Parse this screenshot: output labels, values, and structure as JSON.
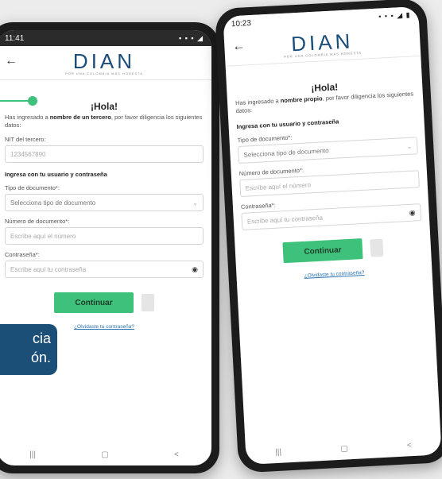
{
  "phone_left": {
    "status_time": "11:41",
    "status_icons": "▪ ▪ ▪ ◢",
    "logo": "DIAN",
    "logo_sub": "POR UNA COLOMBIA MÁS HONESTA",
    "greeting": "¡Hola!",
    "intro_pre": "Has ingresado a ",
    "intro_bold": "nombre de un tercero",
    "intro_post": ", por favor diligencia los siguientes datos:",
    "nit_label": "NIT del tercero:",
    "nit_value": "1234567890",
    "section_title": "Ingresa con tu usuario y contraseña",
    "doc_type_label": "Tipo de documento*:",
    "doc_type_placeholder": "Selecciona tipo de documento",
    "doc_number_label": "Número de documento*:",
    "doc_number_placeholder": "Escribe aquí el número",
    "password_label": "Contraseña*:",
    "password_placeholder": "Escribe aquí tu contraseña",
    "continue_label": "Continuar",
    "forgot_label": "¿Olvidaste tu contraseña?",
    "nav_icons": [
      "|||",
      "▢",
      "<"
    ]
  },
  "phone_right": {
    "status_time": "10:23",
    "status_icons": "▪ ▪ ▪ ◢ ▮",
    "logo": "DIAN",
    "logo_sub": "POR UNA COLOMBIA MÁS HONESTA",
    "greeting": "¡Hola!",
    "intro_pre": "Has ingresado a ",
    "intro_bold": "nombre propio",
    "intro_post": ", por favor diligencia los siguientes datos:",
    "section_title": "Ingresa con tu usuario y contraseña",
    "doc_type_label": "Tipo de documento*:",
    "doc_type_placeholder": "Selecciona tipo de documento",
    "doc_number_label": "Número de documento*:",
    "doc_number_placeholder": "Escribe aquí el número",
    "password_label": "Contraseña*:",
    "password_placeholder": "Escribe aquí tu contraseña",
    "continue_label": "Continuar",
    "forgot_label": "¿Olvidaste tu contraseña?",
    "nav_icons": [
      "|||",
      "▢",
      "<"
    ]
  },
  "callout": {
    "line1": "cia",
    "line2": "ón."
  },
  "colors": {
    "accent": "#3ec17a",
    "brand": "#1a4d7a",
    "callout_bg": "#1b4f78"
  }
}
